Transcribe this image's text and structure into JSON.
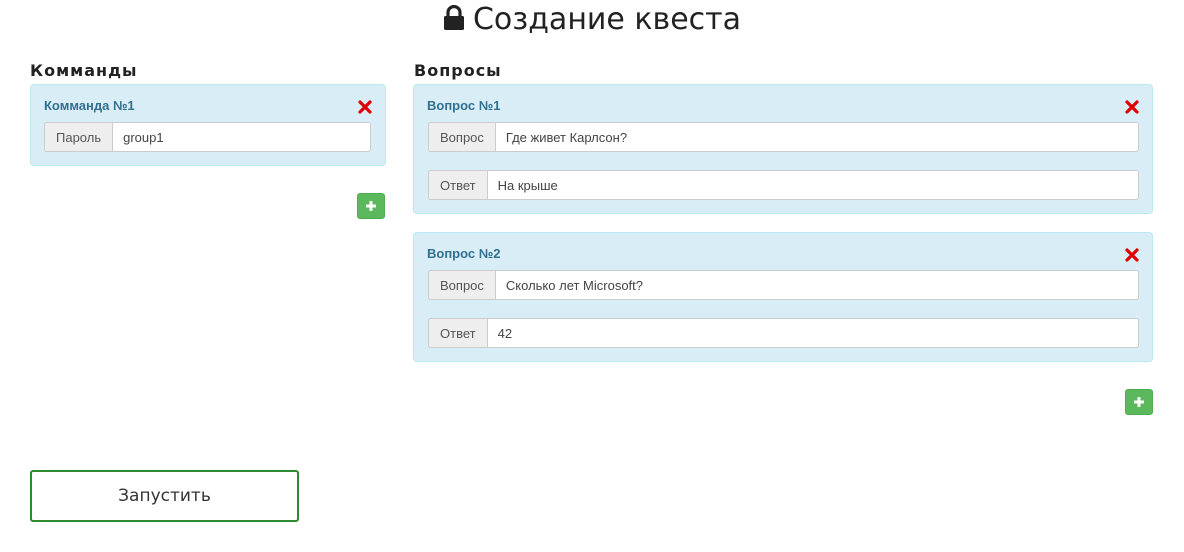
{
  "page": {
    "title": "Создание квеста"
  },
  "teams": {
    "heading": "Комманды",
    "items": [
      {
        "title": "Комманда №1",
        "password_label": "Пароль",
        "password_value": "group1"
      }
    ]
  },
  "questions": {
    "heading": "Вопросы",
    "items": [
      {
        "title": "Вопрос №1",
        "question_label": "Вопрос",
        "question_value": "Где живет Карлсон?",
        "answer_label": "Ответ",
        "answer_value": "На крыше"
      },
      {
        "title": "Вопрос №2",
        "question_label": "Вопрос",
        "question_value": "Сколько лет Microsoft?",
        "answer_label": "Ответ",
        "answer_value": "42"
      }
    ]
  },
  "actions": {
    "run_label": "Запустить"
  },
  "colors": {
    "card_bg": "#d9edf7",
    "card_title": "#31708f",
    "delete": "#e00000",
    "add": "#5cb85c",
    "run_border": "#2f8b2f"
  },
  "icons": {
    "title": "lock-icon",
    "delete": "remove-icon",
    "add": "plus-icon"
  }
}
